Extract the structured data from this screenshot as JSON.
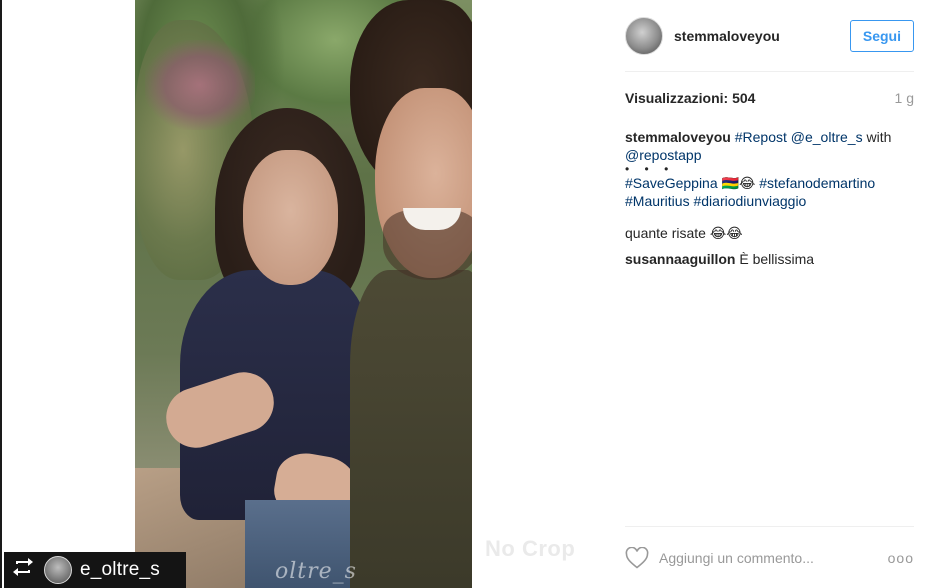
{
  "post": {
    "overlay_text": "oltre_s",
    "watermark": "No Crop"
  },
  "repost_badge": {
    "icon": "repost-icon",
    "username": "e_oltre_s"
  },
  "header": {
    "username": "stemmaloveyou",
    "follow_label": "Segui",
    "accent_color": "#3897f0"
  },
  "stats": {
    "views_label": "Visualizzazioni: 504",
    "age": "1 g"
  },
  "caption": {
    "username": "stemmaloveyou",
    "repost_tag": "#Repost",
    "mention": "@e_oltre_s",
    "with_text": " with",
    "repostapp": "@repostapp",
    "dots": "• • •",
    "hashtag1": "#SaveGeppina",
    "emoji1": "🇲🇺😂",
    "hashtag2": "#stefanodemartino",
    "hashtag3": "#Mauritius",
    "hashtag4": "#diariodiunviaggio"
  },
  "comments": [
    {
      "username": "",
      "text": "quante risate 😂😂"
    },
    {
      "username": "susannaaguillon",
      "text": " È bellissima"
    }
  ],
  "footer": {
    "comment_placeholder": "Aggiungi un commento...",
    "more_label": "ooo"
  }
}
